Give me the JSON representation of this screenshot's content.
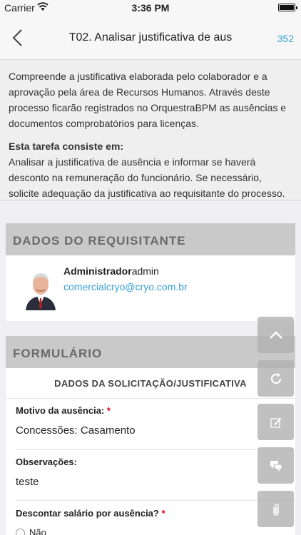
{
  "status_bar": {
    "carrier": "Carrier",
    "time": "3:36 PM"
  },
  "nav": {
    "title": "T02. Analisar justificativa de aus",
    "count": "352"
  },
  "description": {
    "paragraph1": "Compreende a justificativa elaborada pelo colaborador e a aprovação pela área de Recursos Humanos. Através deste processo ficarão registrados no OrquestraBPM as ausências e documentos comprobatórios para licenças.",
    "task_heading": "Esta tarefa consiste em:",
    "task_text": "Analisar a justificativa de ausência e informar se haverá desconto na remuneração do funcionário. Se necessário, solicite adequação da justificativa ao requisitante do processo."
  },
  "requester": {
    "header": "DADOS DO REQUISITANTE",
    "name": "Administrador",
    "login": "admin",
    "email": "comercialcryo@cryo.com.br"
  },
  "form": {
    "header": "FORMULÁRIO",
    "section_title": "DADOS DA SOLICITAÇÃO/JUSTIFICATIVA",
    "fields": [
      {
        "label": "Motivo da ausência:",
        "required": "*",
        "value": "Concessões: Casamento"
      },
      {
        "label": "Observações:",
        "value": "teste"
      },
      {
        "label": "Descontar salário por ausência?",
        "required": "*"
      }
    ],
    "radio_option": "Não"
  },
  "fab_icons": [
    "chevron-up-icon",
    "refresh-icon",
    "edit-icon",
    "chat-icon",
    "paperclip-icon"
  ],
  "colors": {
    "accent": "#3aa0d8",
    "header_bg": "#c9c9c9",
    "required": "#d0021b"
  }
}
